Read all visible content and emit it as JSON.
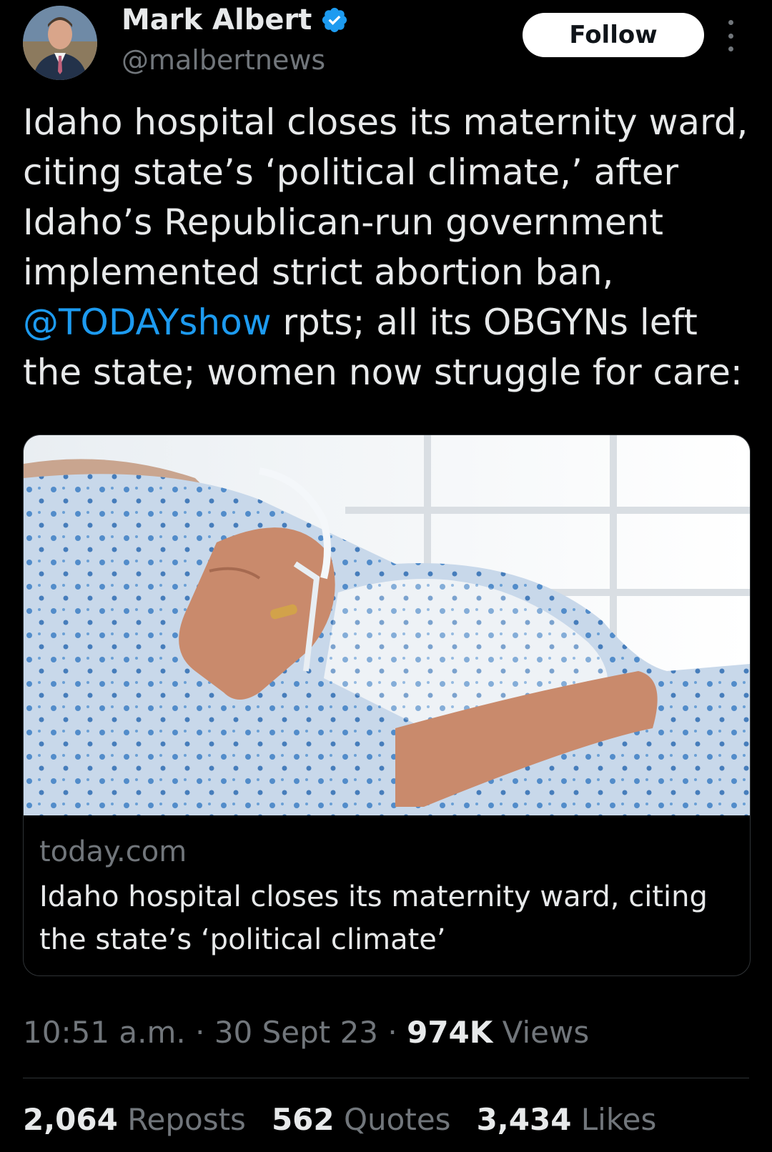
{
  "author": {
    "name": "Mark Albert",
    "handle": "@malbertnews",
    "follow_label": "Follow"
  },
  "tweet": {
    "text_before": "Idaho hospital closes its maternity ward, citing state’s ‘political climate,’ after Idaho’s Republican-run government implemented strict abortion ban, ",
    "mention": "@TODAYshow",
    "text_after": " rpts; all its OBGYNs left the state; women now struggle for care:"
  },
  "link_card": {
    "domain": "today.com",
    "title": "Idaho hospital closes its maternity ward, citing the state’s ‘political climate’"
  },
  "meta": {
    "time": "10:51 a.m.",
    "date": "30 Sept 23",
    "views_count": "974K",
    "views_label": "Views"
  },
  "stats": {
    "reposts_count": "2,064",
    "reposts_label": "Reposts",
    "quotes_count": "562",
    "quotes_label": "Quotes",
    "likes_count": "3,434",
    "likes_label": "Likes"
  },
  "colors": {
    "background": "#000000",
    "link": "#1d9bf0",
    "muted": "#71767b",
    "verified": "#1d9bf0"
  }
}
